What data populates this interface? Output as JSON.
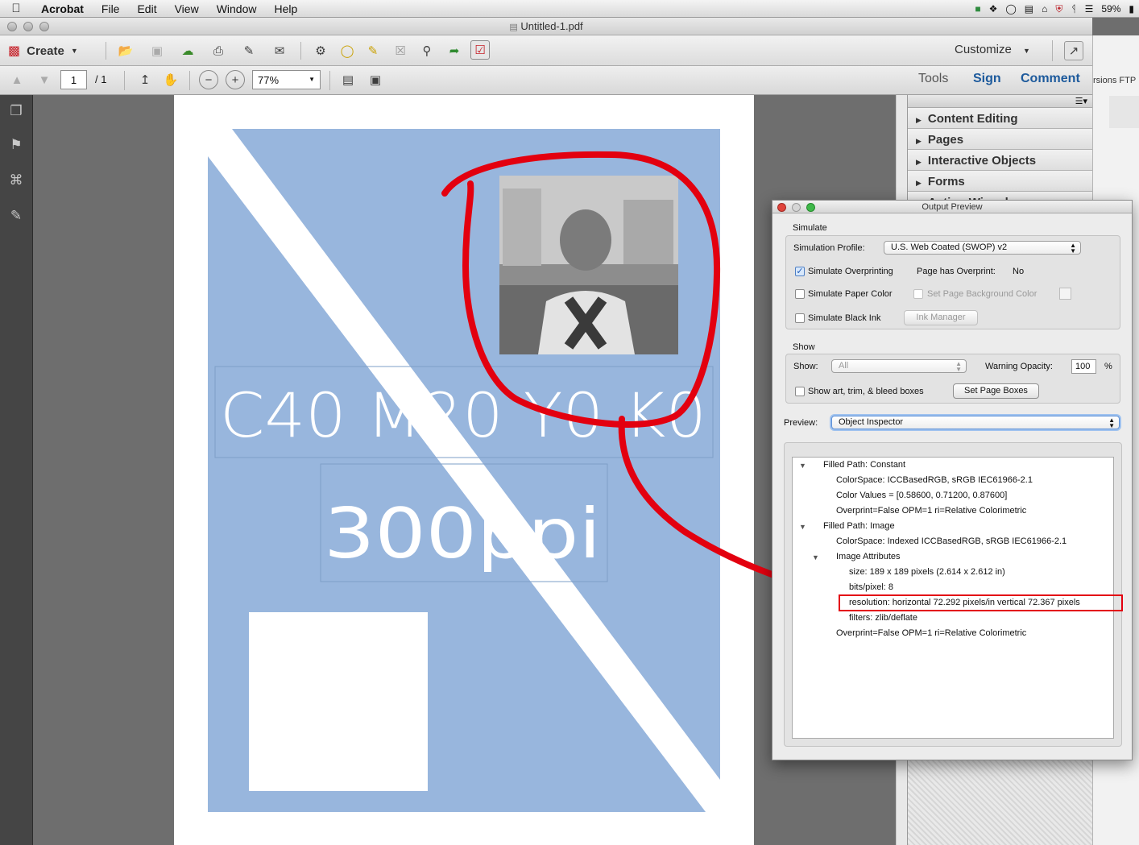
{
  "menubar": {
    "app_name": "Acrobat",
    "menus": [
      "File",
      "Edit",
      "View",
      "Window",
      "Help"
    ],
    "battery": "59%"
  },
  "window": {
    "title": "Untitled-1.pdf"
  },
  "toolbar1": {
    "create_label": "Create",
    "customize_label": "Customize"
  },
  "toolbar2": {
    "page_number": "1",
    "page_total": "/ 1",
    "zoom": "77%",
    "tabs": [
      "Tools",
      "Sign",
      "Comment"
    ]
  },
  "behind_window_text": "rsions FTP",
  "tools_pane": {
    "panels": [
      "Content Editing",
      "Pages",
      "Interactive Objects",
      "Forms",
      "Action Wizard"
    ]
  },
  "pdf": {
    "heading": "C40 M20 Y0 K0",
    "subheading": "300ppi",
    "colors": {
      "background": "#98b6dd",
      "stripe": "#ffffff",
      "annotation": "#e3000f"
    }
  },
  "dialog": {
    "title": "Output Preview",
    "simulate_group": "Simulate",
    "simulation_profile_label": "Simulation Profile:",
    "simulation_profile_value": "U.S. Web Coated (SWOP) v2",
    "simulate_overprinting": "Simulate Overprinting",
    "page_has_overprint_label": "Page has Overprint:",
    "page_has_overprint_value": "No",
    "simulate_paper_color": "Simulate Paper Color",
    "set_page_background": "Set Page Background Color",
    "simulate_black_ink": "Simulate Black Ink",
    "ink_manager": "Ink Manager",
    "show_group": "Show",
    "show_label": "Show:",
    "show_value": "All",
    "warning_opacity_label": "Warning Opacity:",
    "warning_opacity_value": "100",
    "percent": "%",
    "show_boxes": "Show art, trim, & bleed boxes",
    "set_page_boxes": "Set Page Boxes",
    "preview_label": "Preview:",
    "preview_value": "Object Inspector",
    "tree": [
      "Filled Path: Constant",
      "ColorSpace: ICCBasedRGB, sRGB IEC61966-2.1",
      "Color Values = [0.58600, 0.71200, 0.87600]",
      "Overprint=False OPM=1 ri=Relative Colorimetric",
      "Filled Path: Image",
      "ColorSpace: Indexed ICCBasedRGB, sRGB IEC61966-2.1",
      "Image Attributes",
      "size: 189 x 189 pixels (2.614 x 2.612 in)",
      "bits/pixel: 8",
      "resolution: horizontal 72.292 pixels/in vertical 72.367 pixels",
      "filters: zlib/deflate",
      "Overprint=False OPM=1 ri=Relative Colorimetric"
    ]
  }
}
